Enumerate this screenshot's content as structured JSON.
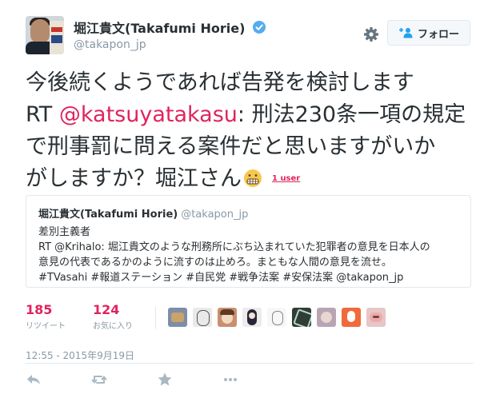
{
  "user": {
    "full_name": "堀江貴文(Takafumi Horie)",
    "username": "@takapon_jp",
    "verified_icon": "verified-badge-icon",
    "avatar_icon": "profile-photo"
  },
  "header": {
    "follow_label": "フォロー",
    "follow_icon": "add-person-icon",
    "settings_icon": "gear-icon"
  },
  "tweet": {
    "line1": "今後続くようであれば告発を検討します",
    "line2_prefix": "RT ",
    "line2_mention": "@katsuyatakasu",
    "line2_rest": ": 刑法230条一項の規定",
    "line3": "で刑事罰に問える案件だと思いますがいか",
    "line4": "がしますか？堀江さん",
    "emoji_icon": "grimacing-face-icon",
    "user_tag": "1 user"
  },
  "quote": {
    "name": "堀江貴文(Takafumi Horie)",
    "username": "@takapon_jp",
    "lines": [
      "差別主義者",
      "RT @Krihalo: 堀江貴文のような刑務所にぶち込まれていた犯罪者の意見を日本人の",
      "意見の代表であるかのように流すのは止めろ。まともな人間の意見を流せ。",
      "#TVasahi #報道ステーション #自民党 #戦争法案 #安保法案 @takapon_jp"
    ]
  },
  "stats": {
    "retweets": "185",
    "retweets_label": "リツイート",
    "favorites": "124",
    "favorites_label": "お気に入り"
  },
  "timestamp": "12:55 - 2015年9月19日",
  "actions": {
    "reply_icon": "reply-icon",
    "retweet_icon": "retweet-icon",
    "favorite_icon": "star-icon",
    "more_icon": "more-icon"
  },
  "colors": {
    "accent": "#e0245e",
    "text": "#292f33",
    "muted": "#8899a6",
    "border": "#e1e8ed",
    "verified": "#55acee"
  }
}
